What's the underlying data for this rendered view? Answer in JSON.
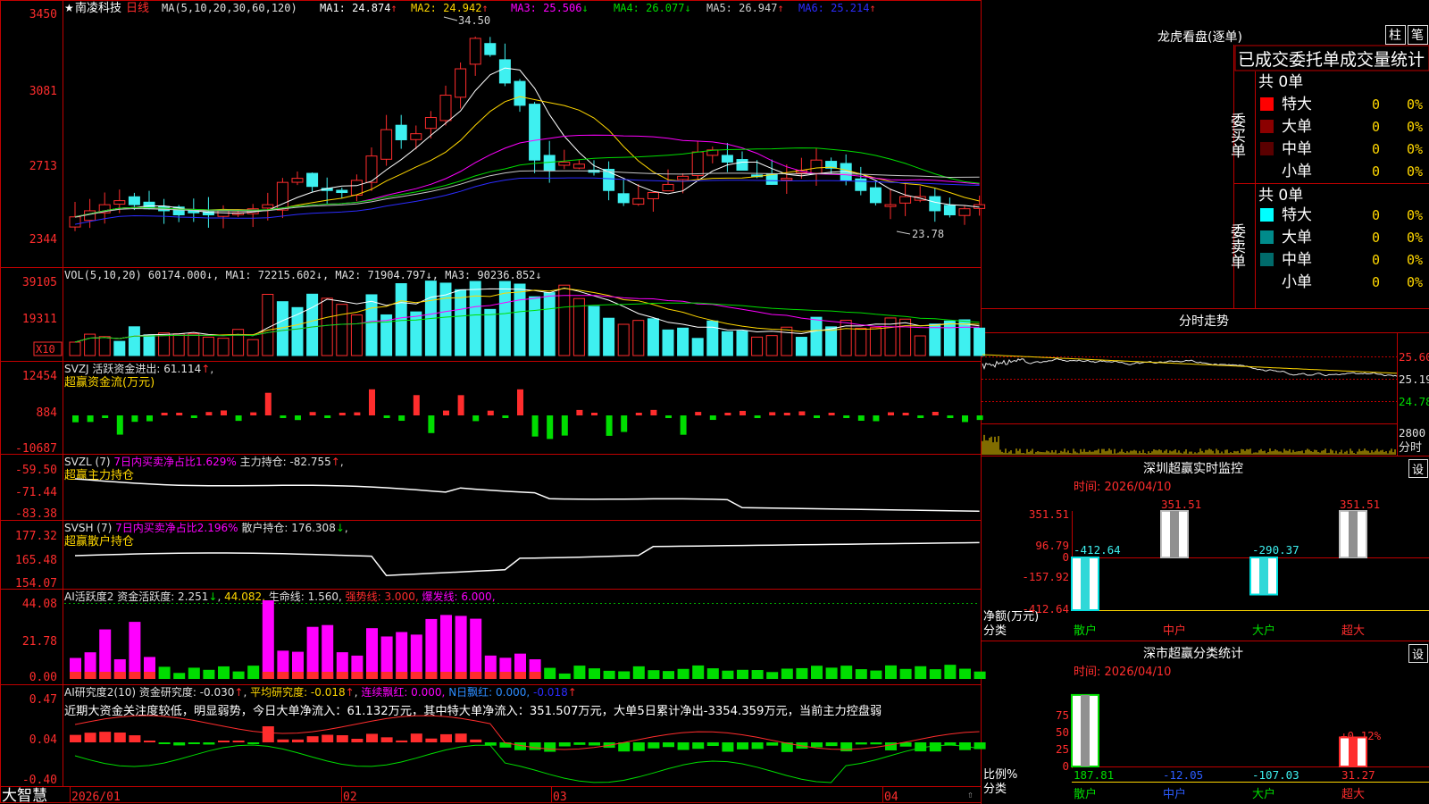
{
  "app": {
    "brand": "大智慧",
    "chevron": "⇧"
  },
  "colors": {
    "bg": "#000000",
    "frame": "#c00000",
    "up": "#ff2d2d",
    "down": "#3ef0f0",
    "white": "#ffffff",
    "yellow": "#ffd700",
    "magenta": "#ff00ff",
    "green": "#00dd00",
    "grey": "#a0a0a0",
    "blue": "#2c2cff"
  },
  "main": {
    "header": {
      "star": "★",
      "name": "南凌科技",
      "period": "日线",
      "ma_label": "MA(5,10,20,30,60,120)"
    },
    "ma_items": [
      {
        "label": "MA1: 24.874",
        "arrow": "↑",
        "color": "#ffffff"
      },
      {
        "label": "MA2: 24.942",
        "arrow": "↑",
        "color": "#ffd700"
      },
      {
        "label": "MA3: 25.506",
        "arrow": "↓",
        "color": "#ff00ff"
      },
      {
        "label": "MA4: 26.077",
        "arrow": "↓",
        "color": "#00dd00"
      },
      {
        "label": "MA5: 26.947",
        "arrow": "↑",
        "color": "#d0d0d0"
      },
      {
        "label": "MA6: 25.214",
        "arrow": "↑",
        "color": "#2c2cff"
      }
    ],
    "y_ticks": [
      "3450",
      "3081",
      "2713",
      "2344"
    ],
    "high_label": "34.50",
    "low_label": "23.78"
  },
  "volume": {
    "header": "VOL(5,10,20) 60174.000↓, MA1: 72215.602↓, MA2: 71904.797↓, MA3: 90236.852↓",
    "y_ticks": [
      "39105",
      "19311"
    ],
    "unit": "X10"
  },
  "svzj": {
    "header_a": "SVZJ  活跃资金进出: 61.114",
    "header_a_arrow": "↑",
    "header_b": "超赢资金流(万元)",
    "y_ticks": [
      "12454",
      "884",
      "-10687"
    ]
  },
  "svzl": {
    "header_a": "SVZL (7)",
    "header_b": "7日内买卖净占比1.629%",
    "header_c": "主力持仓: -82.755",
    "header_c_arrow": "↑",
    "header_d": "超赢主力持仓",
    "y_ticks": [
      "-59.50",
      "-71.44",
      "-83.38"
    ]
  },
  "svsh": {
    "header_a": "SVSH (7)",
    "header_b": "7日内买卖净占比2.196%",
    "header_c": "散户持仓: 176.308",
    "header_c_arrow": "↓",
    "header_d": "超赢散户持仓",
    "y_ticks": [
      "177.32",
      "165.48",
      "154.07"
    ]
  },
  "ai_active": {
    "header_a": "AI活跃度2 资金活跃度: 2.251",
    "header_a_arrow": "↓",
    "header_b": "44.082,",
    "header_c": "生命线: 1.560,",
    "header_d": "强势线: 3.000,",
    "header_e": "爆发线: 6.000,",
    "y_ticks": [
      "44.08",
      "21.78",
      "0.00"
    ]
  },
  "ai_research": {
    "header_a": "AI研究度2(10) 资金研究度: -0.030",
    "header_a_arrow": "↑",
    "header_b": "平均研究度: -0.018",
    "header_b_arrow": "↑",
    "header_c": "连续飘红: 0.000,",
    "header_d": "N日飘红: 0.000,",
    "header_e": "-0.018",
    "header_e_arrow": "↑",
    "summary": "近期大资金关注度较低，明显弱势，今日大单净流入：61.132万元，其中特大单净流入：351.507万元，大单5日累计净出-3354.359万元，当前主力控盘弱",
    "y_ticks": [
      "0.47",
      "0.04",
      "-0.40"
    ]
  },
  "date_axis": [
    "2026/01",
    "02",
    "03",
    "04"
  ],
  "dragon": {
    "title": "龙虎看盘(逐单)",
    "btn_a": "柱",
    "btn_b": "笔",
    "tabs": "已成交委托单成交量统计",
    "buy": {
      "side": "委买单",
      "total": "共 0单",
      "rows": [
        {
          "label": "特大",
          "count": "0",
          "pct": "0%",
          "color": "#ff0000"
        },
        {
          "label": "大单",
          "count": "0",
          "pct": "0%",
          "color": "#8b0000"
        },
        {
          "label": "中单",
          "count": "0",
          "pct": "0%",
          "color": "#5a0000"
        },
        {
          "label": "小单",
          "count": "0",
          "pct": "0%",
          "color": "#000000"
        }
      ]
    },
    "sell": {
      "side": "委卖单",
      "total": "共 0单",
      "rows": [
        {
          "label": "特大",
          "count": "0",
          "pct": "0%",
          "color": "#00ffff"
        },
        {
          "label": "大单",
          "count": "0",
          "pct": "0%",
          "color": "#008b8b"
        },
        {
          "label": "中单",
          "count": "0",
          "pct": "0%",
          "color": "#006a6a"
        },
        {
          "label": "小单",
          "count": "0",
          "pct": "0%",
          "color": "#000000"
        }
      ]
    }
  },
  "intraday": {
    "title": "分时走势",
    "y_ticks": [
      "25.60",
      "25.19",
      "24.78"
    ],
    "vol_tick": "2800",
    "vol_label": "分时"
  },
  "monitor": {
    "title": "深圳超赢实时监控",
    "btn": "设",
    "time": "时间: 2026/04/10",
    "y_ticks": [
      "351.51",
      "96.79",
      "0",
      "-157.92",
      "-412.64"
    ],
    "unit_a": "净额(万元)",
    "unit_b": "分类",
    "categories": [
      "散户",
      "中户",
      "大户",
      "超大"
    ],
    "chart_data": {
      "type": "bar",
      "categories": [
        "散户",
        "中户",
        "大户",
        "超大"
      ],
      "values": [
        -412.64,
        351.51,
        -290.37,
        351.51
      ],
      "ylim": [
        -412.64,
        351.51
      ]
    },
    "labels": [
      "-412.64",
      "351.51",
      "-290.37",
      "351.51"
    ]
  },
  "classify": {
    "title": "深市超赢分类统计",
    "btn": "设",
    "time": "时间: 2026/04/10",
    "y_ticks": [
      "75",
      "50",
      "25",
      "0"
    ],
    "unit_a": "比例%",
    "unit_b": "分类",
    "categories": [
      "散户",
      "中户",
      "大户",
      "超大"
    ],
    "pct_label": "+0.12%",
    "values": [
      "187.81",
      "-12.05",
      "-107.03",
      "31.27"
    ],
    "chart_data": {
      "type": "bar",
      "categories": [
        "散户",
        "中户",
        "大户",
        "超大"
      ],
      "values": [
        187.81,
        -12.05,
        -107.03,
        31.27
      ],
      "ylim": [
        0,
        75
      ]
    }
  }
}
